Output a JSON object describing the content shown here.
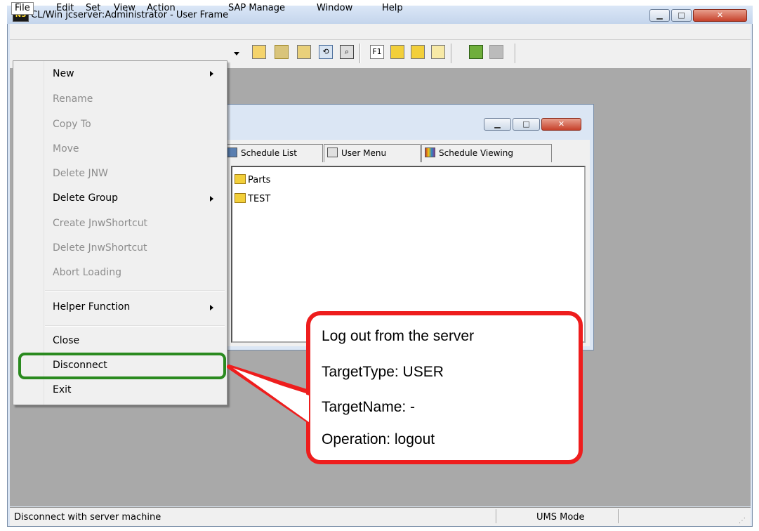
{
  "window": {
    "title": "CL/Win jcserver:Administrator - User Frame",
    "app_icon_text": "NS"
  },
  "menubar": [
    "File",
    "Edit",
    "Set",
    "View",
    "Action",
    "SAP Manage",
    "Window",
    "Help"
  ],
  "file_menu": {
    "items": {
      "new": "New",
      "rename": "Rename",
      "copy_to": "Copy To",
      "move": "Move",
      "delete_jnw": "Delete JNW",
      "delete_group": "Delete Group",
      "create_shortcut": "Create JnwShortcut",
      "delete_shortcut": "Delete JnwShortcut",
      "abort_loading": "Abort Loading",
      "helper_function": "Helper Function",
      "close": "Close",
      "disconnect": "Disconnect",
      "exit": "Exit"
    }
  },
  "child_window": {
    "tabs": [
      "Schedule List",
      "User Menu",
      "Schedule Viewing"
    ],
    "tree_items": [
      "Parts",
      "TEST"
    ]
  },
  "callout": {
    "lines": [
      "Log out from the server",
      "TargetType: USER",
      "TargetName: -",
      "Operation: logout"
    ]
  },
  "statusbar": {
    "message": "Disconnect with server machine",
    "mode": "UMS Mode"
  },
  "colors": {
    "callout_border": "#ee1d1d",
    "highlight_border": "#2a8a1f",
    "workspace": "#a9a9a9"
  }
}
